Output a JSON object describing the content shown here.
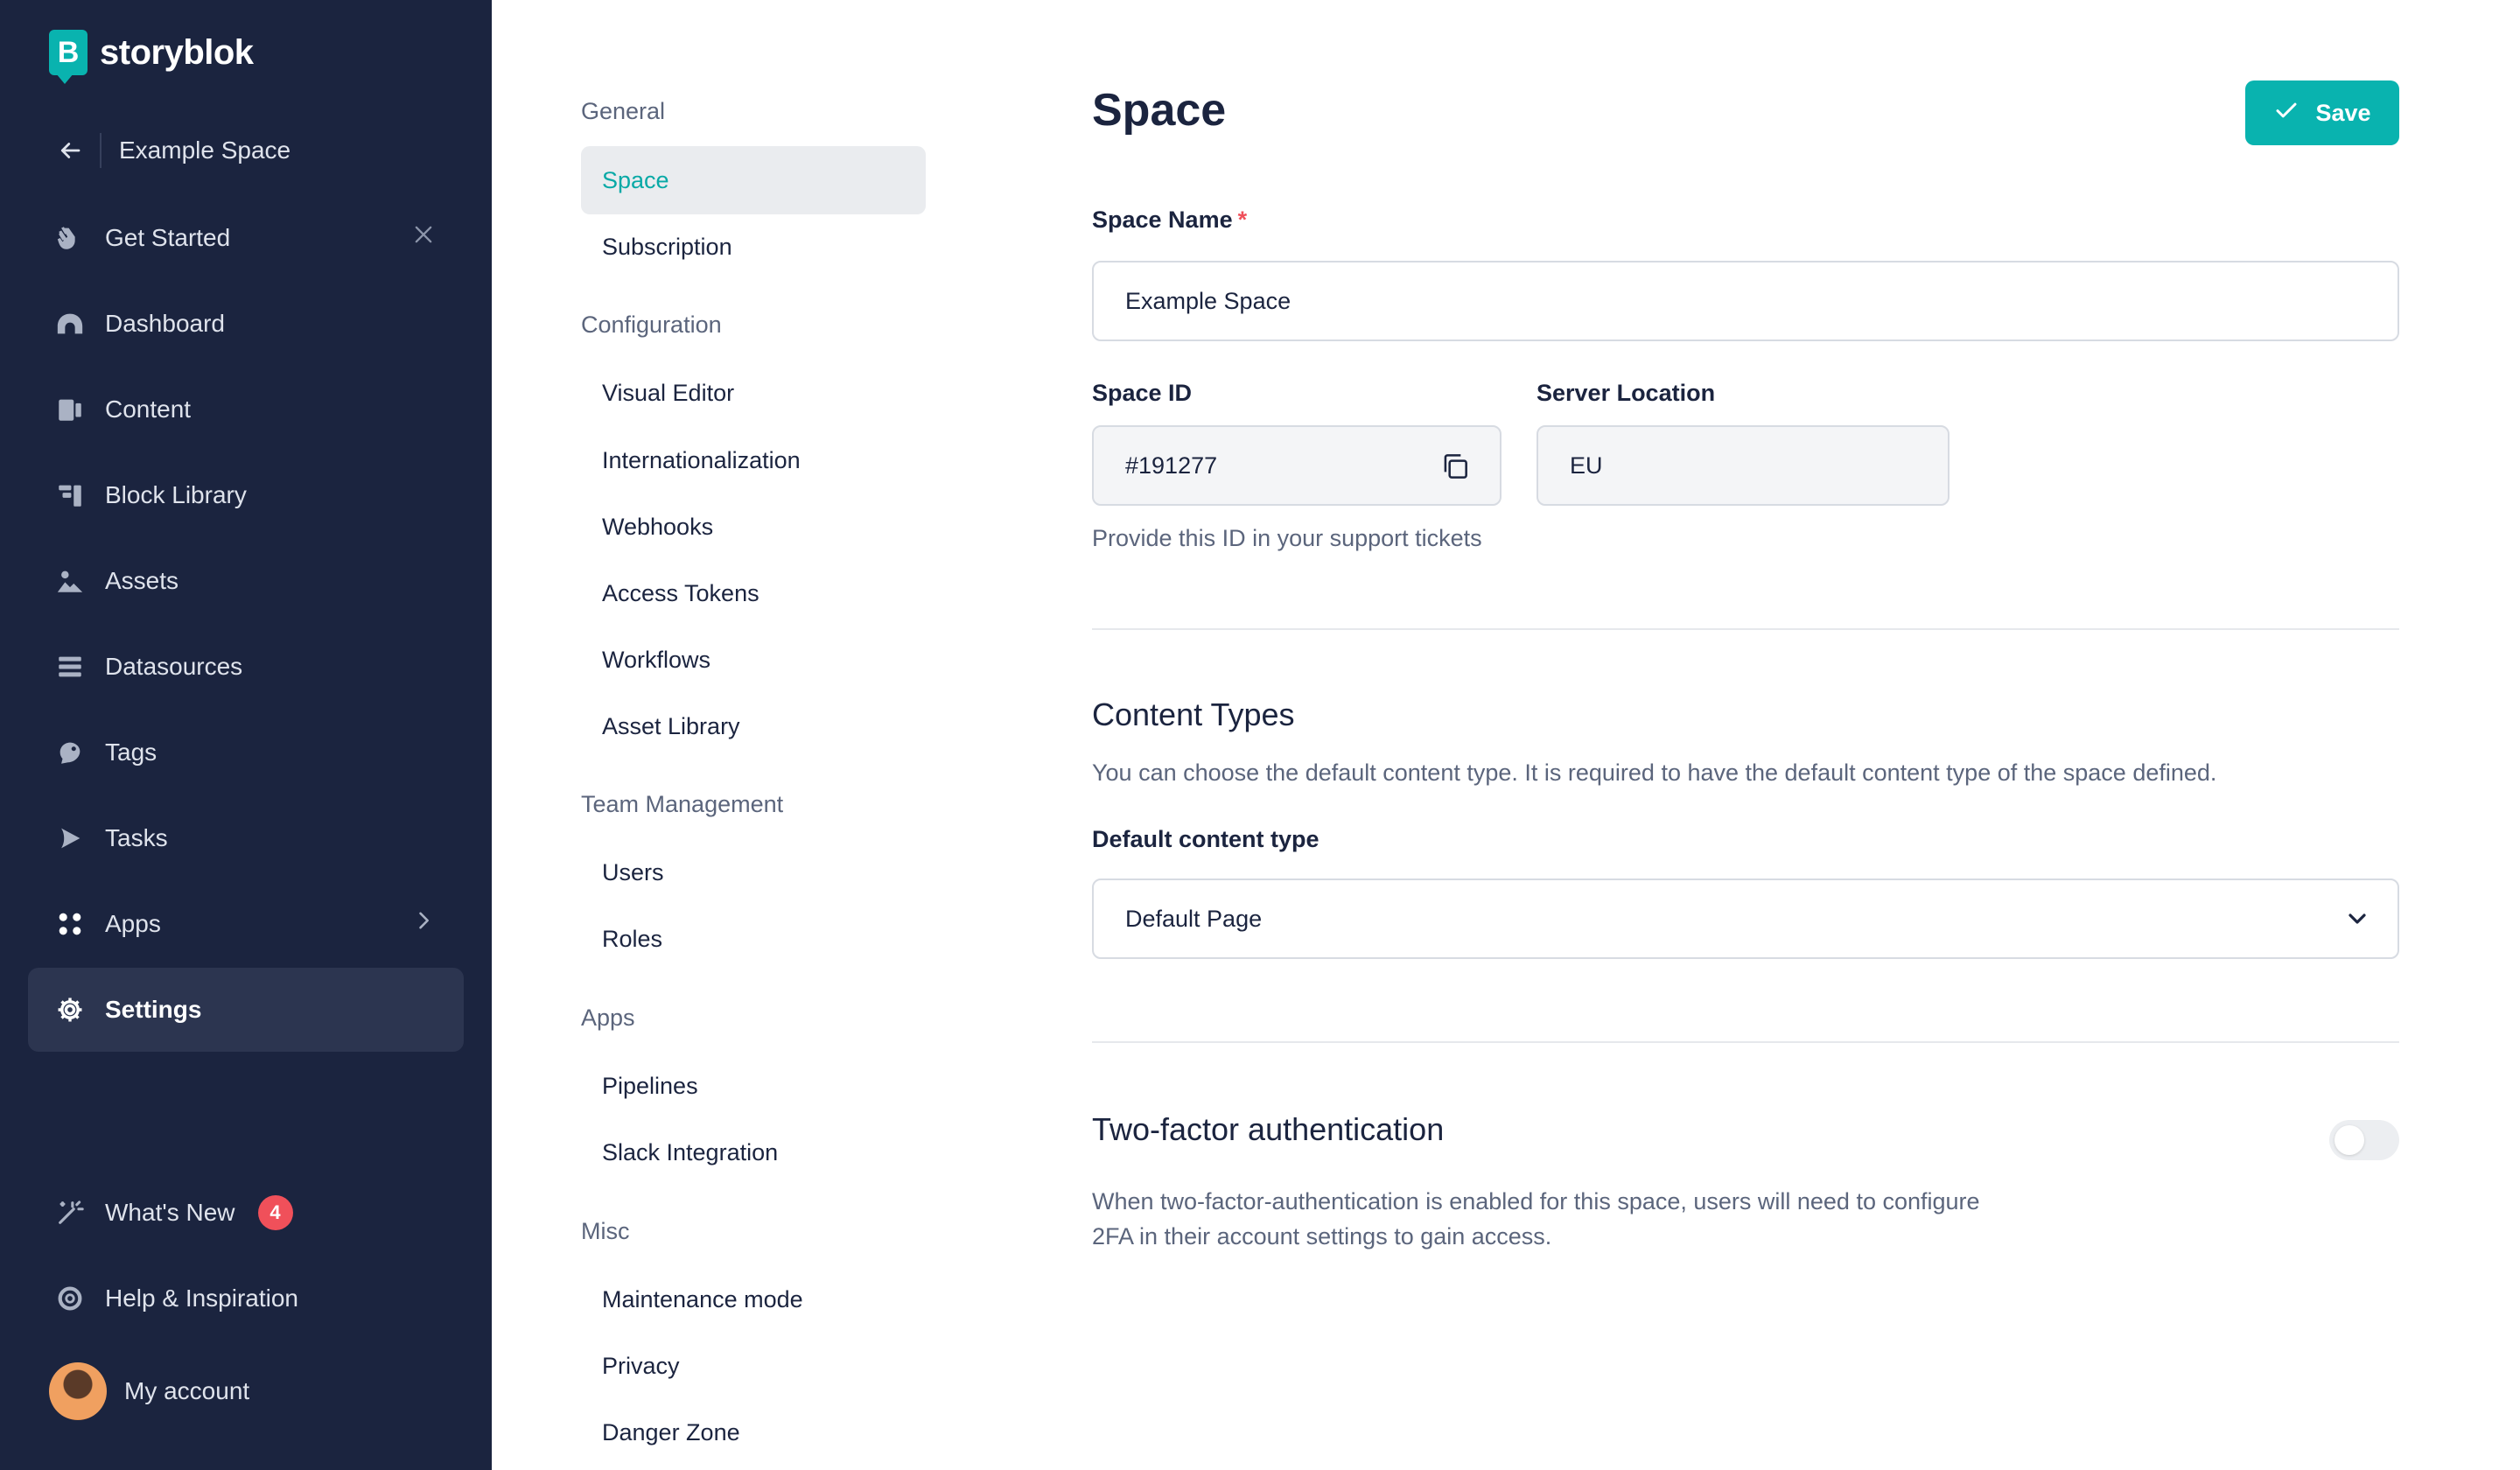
{
  "app": {
    "brand": "storyblok",
    "accent": "#09b3af"
  },
  "sidebar": {
    "back_label": "Example Space",
    "items": [
      {
        "label": "Get Started",
        "icon": "hand-wave-icon"
      },
      {
        "label": "Dashboard",
        "icon": "dashboard-gauge-icon"
      },
      {
        "label": "Content",
        "icon": "content-icon"
      },
      {
        "label": "Block Library",
        "icon": "block-library-icon"
      },
      {
        "label": "Assets",
        "icon": "assets-icon"
      },
      {
        "label": "Datasources",
        "icon": "datasources-icon"
      },
      {
        "label": "Tags",
        "icon": "tags-icon"
      },
      {
        "label": "Tasks",
        "icon": "tasks-icon"
      },
      {
        "label": "Apps",
        "icon": "apps-icon"
      },
      {
        "label": "Settings",
        "icon": "gear-icon"
      }
    ],
    "whats_new": {
      "label": "What's New",
      "badge": "4"
    },
    "help_label": "Help & Inspiration",
    "account_label": "My account"
  },
  "subnav": {
    "general": "General",
    "space": "Space",
    "subscription": "Subscription",
    "configuration": "Configuration",
    "visual_editor": "Visual Editor",
    "internationalization": "Internationalization",
    "webhooks": "Webhooks",
    "access_tokens": "Access Tokens",
    "workflows": "Workflows",
    "asset_library": "Asset Library",
    "team_management": "Team Management",
    "users": "Users",
    "roles": "Roles",
    "apps": "Apps",
    "pipelines": "Pipelines",
    "slack_integration": "Slack Integration",
    "misc": "Misc",
    "maintenance_mode": "Maintenance mode",
    "privacy": "Privacy",
    "danger_zone": "Danger Zone"
  },
  "main": {
    "title": "Space",
    "save_label": "Save",
    "space_name_label": "Space Name",
    "required_marker": "*",
    "space_name_value": "Example Space",
    "space_id_label": "Space ID",
    "space_id_value": "#191277",
    "server_location_label": "Server Location",
    "server_location_value": "EU",
    "space_id_help": "Provide this ID in your support tickets",
    "content_types_title": "Content Types",
    "content_types_desc": "You can choose the default content type. It is required to have the default content type of the space defined.",
    "default_content_type_label": "Default content type",
    "default_content_type_value": "Default Page",
    "twofa_title": "Two-factor authentication",
    "twofa_desc_line1": "When two-factor-authentication is enabled for this space, users will need to configure",
    "twofa_desc_line2": "2FA in their account settings to gain access.",
    "twofa_enabled": false
  }
}
